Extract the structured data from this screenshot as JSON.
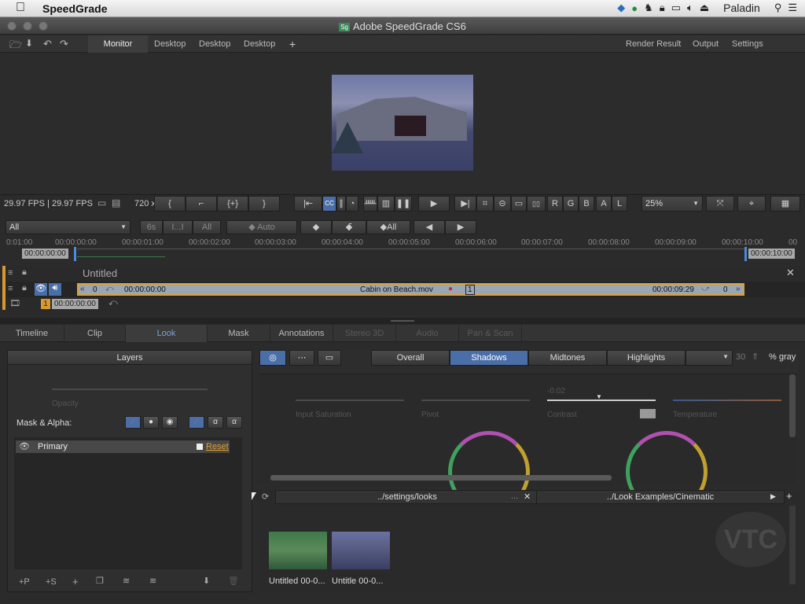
{
  "menubar": {
    "app_name": "SpeedGrade",
    "user": "Paladin",
    "icons": [
      "apple-icon",
      "dropbox-icon",
      "globe-icon",
      "evernote-icon",
      "lock-icon",
      "airplay-icon",
      "volume-icon",
      "eject-icon",
      "search-icon",
      "list-icon"
    ]
  },
  "window": {
    "title": "Adobe SpeedGrade CS6",
    "icon_label": "Sg"
  },
  "tabs": {
    "left": [
      "Monitor",
      "Desktop",
      "Desktop",
      "Desktop"
    ],
    "add": "+",
    "right": [
      "Render Result",
      "Output",
      "Settings"
    ],
    "active": "Monitor"
  },
  "transport": {
    "fps_info": "29.97 FPS  |  29.97 FPS",
    "res_info": "720 x",
    "channels": [
      "R",
      "G",
      "B",
      "A",
      "L"
    ],
    "zoom": "25%"
  },
  "filter": {
    "dropdown": "All",
    "btn_6s": "6s",
    "btn_ii": "I...I",
    "btn_all": "All",
    "btn_auto": "Auto",
    "btn_all2": "All"
  },
  "ruler": {
    "ticks": [
      "0:01:00",
      "00:00:00:00",
      "00:00:01:00",
      "00:00:02:00",
      "00:00:03:00",
      "00:00:04:00",
      "00:00:05:00",
      "00:00:06:00",
      "00:00:07:00",
      "00:00:08:00",
      "00:00:09:00",
      "00:00:10:00",
      "00"
    ],
    "in_tc": "00:00:00:00",
    "out_tc": "00:00:10:00"
  },
  "tracks": {
    "sequence_name": "Untitled",
    "clip_left_num": "0",
    "clip_start": "00:00:00:00",
    "clip_name": "Cabin on Beach.mov",
    "clip_badge": "1",
    "clip_end": "00:00:09:29",
    "clip_right_num": "0",
    "sub_badge": "1",
    "sub_tc": "00:00:00:00"
  },
  "panel_tabs": {
    "items": [
      "Timeline",
      "Clip",
      "Look",
      "Mask",
      "Annotations",
      "Stereo 3D",
      "Audio",
      "Pan & Scan"
    ],
    "active": "Look",
    "disabled": [
      "Stereo 3D",
      "Audio",
      "Pan & Scan"
    ]
  },
  "layers": {
    "title": "Layers",
    "opacity_label": "Opacity",
    "mask_alpha_label": "Mask & Alpha:",
    "primary_label": "Primary",
    "reset_label": "Reset",
    "footer": [
      "+P",
      "+S",
      "+"
    ]
  },
  "look": {
    "tone_tabs": [
      "Overall",
      "Shadows",
      "Midtones",
      "Highlights"
    ],
    "active_tone": "Shadows",
    "gray_value": "30",
    "gray_label": "% gray",
    "contrast_value": "-0.02",
    "sliders": [
      "Input Saturation",
      "Pivot",
      "Contrast",
      "Temperature"
    ]
  },
  "browser": {
    "left_path": "../settings/looks",
    "left_dots": "...",
    "right_path": "../Look Examples/Cinematic",
    "thumbs": [
      "Untitled 00-0...",
      "Untitle 00-0..."
    ]
  }
}
